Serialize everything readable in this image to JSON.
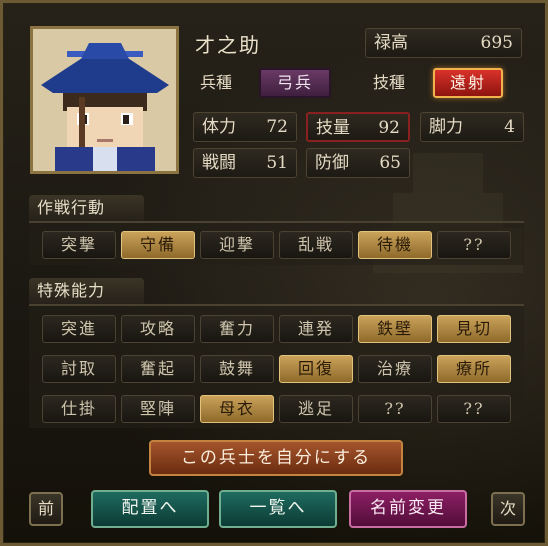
{
  "unit": {
    "name": "才之助"
  },
  "header": {
    "stipend": {
      "label": "禄高",
      "value": "695"
    },
    "troop_type": {
      "label": "兵種",
      "value": "弓兵"
    },
    "skill_type": {
      "label": "技種",
      "value": "遠射"
    }
  },
  "stats": [
    {
      "label": "体力",
      "value": "72"
    },
    {
      "label": "技量",
      "value": "92"
    },
    {
      "label": "脚力",
      "value": "4"
    },
    {
      "label": "戦闘",
      "value": "51"
    },
    {
      "label": "防御",
      "value": "65"
    }
  ],
  "tactics": {
    "title": "作戦行動",
    "items": [
      {
        "label": "突撃",
        "active": false
      },
      {
        "label": "守備",
        "active": true
      },
      {
        "label": "迎撃",
        "active": false
      },
      {
        "label": "乱戦",
        "active": false
      },
      {
        "label": "待機",
        "active": true
      },
      {
        "label": "??",
        "active": false
      }
    ]
  },
  "abilities": {
    "title": "特殊能力",
    "rows": [
      [
        {
          "label": "突進",
          "active": false
        },
        {
          "label": "攻略",
          "active": false
        },
        {
          "label": "奮力",
          "active": false
        },
        {
          "label": "連発",
          "active": false
        },
        {
          "label": "鉄壁",
          "active": true
        },
        {
          "label": "見切",
          "active": true
        }
      ],
      [
        {
          "label": "討取",
          "active": false
        },
        {
          "label": "奮起",
          "active": false
        },
        {
          "label": "鼓舞",
          "active": false
        },
        {
          "label": "回復",
          "active": true
        },
        {
          "label": "治療",
          "active": false
        },
        {
          "label": "療所",
          "active": true
        }
      ],
      [
        {
          "label": "仕掛",
          "active": false
        },
        {
          "label": "堅陣",
          "active": false
        },
        {
          "label": "母衣",
          "active": true
        },
        {
          "label": "逃足",
          "active": false
        },
        {
          "label": "??",
          "active": false
        },
        {
          "label": "??",
          "active": false
        }
      ]
    ]
  },
  "actions": {
    "make_own": "この兵士を自分にする",
    "prev": "前",
    "deploy": "配置へ",
    "list": "一覧へ",
    "rename": "名前変更",
    "next": "次"
  },
  "colors": {
    "active_gold": "#caa25a",
    "troop_purple": "#6a3a66",
    "skill_red": "#d8322a",
    "cmd_teal": "#1f6b60",
    "cmd_magenta": "#8c1f64",
    "cmd_brown": "#a5552c"
  }
}
